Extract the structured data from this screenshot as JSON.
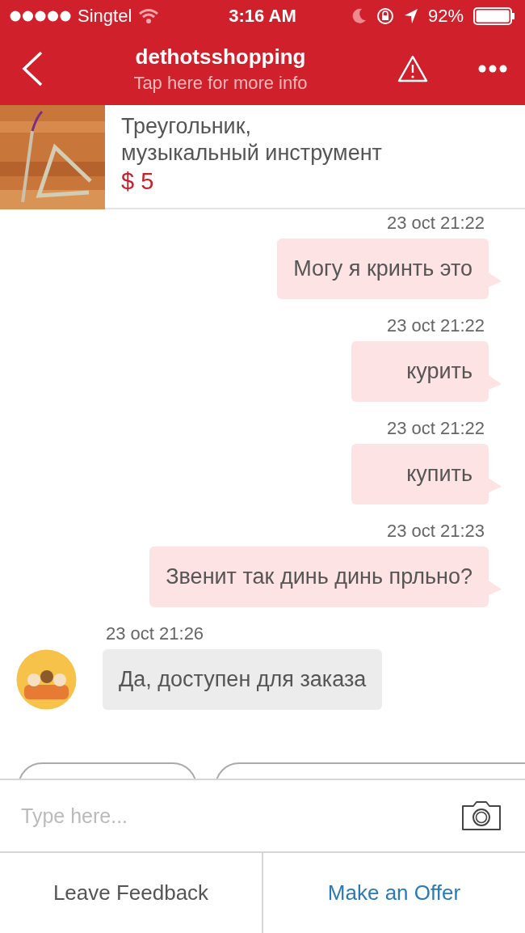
{
  "status_bar": {
    "carrier": "Singtel",
    "time": "3:16 AM",
    "battery": "92%"
  },
  "nav": {
    "title": "dethotsshopping",
    "subtitle": "Tap here for more info"
  },
  "product": {
    "title_lines": [
      "Треугольник,",
      "музыкальный инструмент"
    ],
    "price": "$ 5"
  },
  "messages": [
    {
      "kind": "outgoing",
      "time": "23 oct 21:22",
      "text": "Могу я кринть это"
    },
    {
      "kind": "outgoing",
      "time": "23 oct 21:22",
      "text": "курить"
    },
    {
      "kind": "outgoing",
      "time": "23 oct 21:22",
      "text": "купить"
    },
    {
      "kind": "outgoing",
      "time": "23 oct 21:23",
      "text": "Звенит так динь динь прльно?"
    },
    {
      "kind": "incoming",
      "time": "23 oct 21:26",
      "text": "Да, доступен для заказа"
    }
  ],
  "quick_replies": [
    {
      "kind": "chip"
    },
    {
      "kind": "chip"
    }
  ],
  "composer": {
    "placeholder": "Type here..."
  },
  "actions": [
    {
      "label": "Leave Feedback",
      "kind": "plain"
    },
    {
      "label": "Make an Offer",
      "kind": "primary"
    }
  ]
}
